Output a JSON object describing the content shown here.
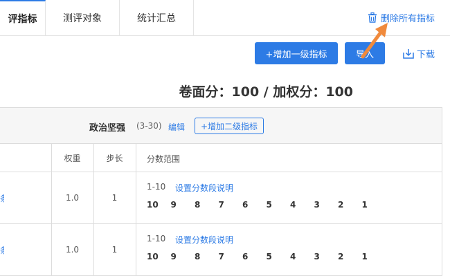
{
  "tabs": [
    {
      "label": "评指标",
      "active": true
    },
    {
      "label": "测评对象",
      "active": false
    },
    {
      "label": "统计汇总",
      "active": false
    }
  ],
  "delete_all_label": "删除所有指标",
  "toolbar": {
    "add_level1_label": "+增加一级指标",
    "import_label": "导入",
    "download_label": "下载"
  },
  "score_summary": "卷面分：100 / 加权分：100",
  "group": {
    "title": "政治坚强",
    "range": "(3-30)",
    "edit_label": "编辑",
    "add_level2_label": "+增加二级指标"
  },
  "columns": {
    "weight": "权重",
    "step": "步长",
    "score_range": "分数范围"
  },
  "rows": [
    {
      "edge_text": "条",
      "weight": "1.0",
      "step": "1",
      "range": "1-10",
      "range_link": "设置分数段说明",
      "scores": [
        "10",
        "9",
        "8",
        "7",
        "6",
        "5",
        "4",
        "3",
        "2",
        "1"
      ]
    },
    {
      "edge_text": "条",
      "weight": "1.0",
      "step": "1",
      "range": "1-10",
      "range_link": "设置分数段说明",
      "scores": [
        "10",
        "9",
        "8",
        "7",
        "6",
        "5",
        "4",
        "3",
        "2",
        "1"
      ]
    }
  ],
  "colors": {
    "accent": "#2d7be5",
    "annotation_arrow": "#f08a3c"
  }
}
